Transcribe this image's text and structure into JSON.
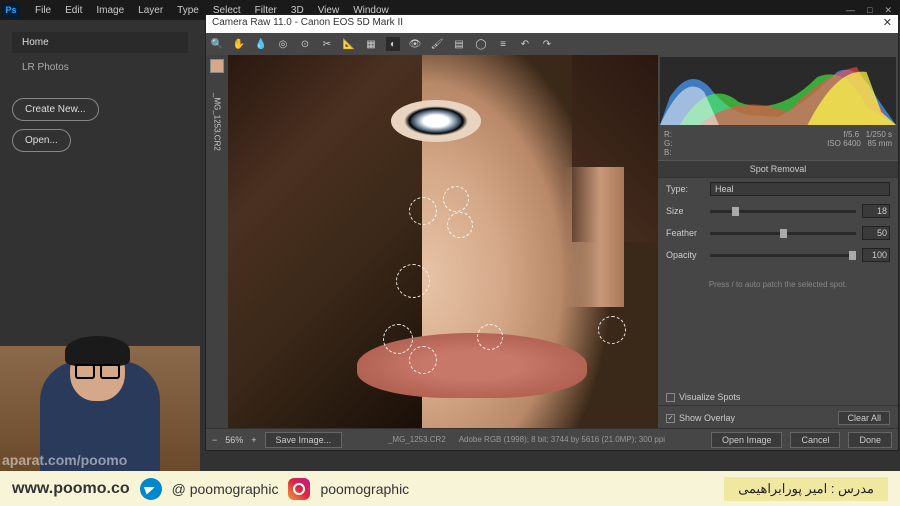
{
  "menubar": {
    "items": [
      "File",
      "Edit",
      "Image",
      "Layer",
      "Type",
      "Select",
      "Filter",
      "3D",
      "View",
      "Window"
    ]
  },
  "sidebar": {
    "home": "Home",
    "lr": "LR Photos",
    "create": "Create New...",
    "open": "Open..."
  },
  "cr": {
    "title": "Camera Raw 11.0  -  Canon EOS 5D Mark II",
    "filename": "_MG_1253.CR2",
    "meta": {
      "left_r": "R:",
      "left_g": "G:",
      "left_b": "B:",
      "aperture": "f/5.6",
      "shutter": "1/250 s",
      "iso": "ISO 6400",
      "focal": "85 mm"
    },
    "panel": "Spot Removal",
    "type_label": "Type:",
    "type_value": "Heal",
    "size_label": "Size",
    "size_value": "18",
    "feather_label": "Feather",
    "feather_value": "50",
    "opacity_label": "Opacity",
    "opacity_value": "100",
    "hint": "Press / to auto patch the selected spot.",
    "visualize": "Visualize Spots",
    "overlay": "Show Overlay",
    "clear": "Clear All",
    "zoom_minus": "−",
    "zoom_plus": "+",
    "zoom": "56%",
    "save": "Save Image...",
    "color_info": "Adobe RGB (1998); 8 bit; 3744 by 5616 (21.0MP); 300 ppi",
    "open_img": "Open Image",
    "cancel": "Cancel",
    "done": "Done"
  },
  "social": {
    "url": "www.poomo.co",
    "handle1": "@ poomographic",
    "handle2": "poomographic",
    "credit": "مدرس : امیر پورابراهیمی"
  },
  "watermark": "aparat.com/poomo"
}
